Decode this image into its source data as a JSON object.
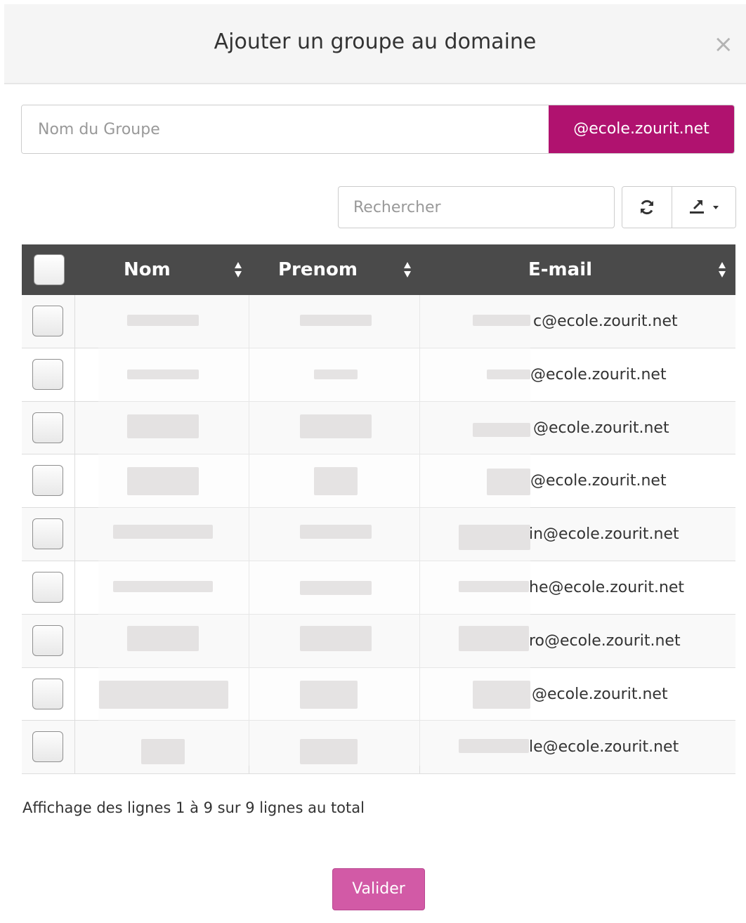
{
  "modal": {
    "title": "Ajouter un groupe au domaine",
    "close_label": "×"
  },
  "group_form": {
    "name_placeholder": "Nom du Groupe",
    "domain_suffix": "@ecole.zourit.net",
    "accent_color": "#b0126f"
  },
  "toolbar": {
    "search_placeholder": "Rechercher",
    "refresh_icon": "refresh-icon",
    "export_icon": "export-icon"
  },
  "table": {
    "header_bg": "#4a4a4a",
    "columns": [
      "Nom",
      "Prenom",
      "E-mail"
    ],
    "rows": [
      {
        "email_visible": "c@ecole.zourit.net"
      },
      {
        "email_visible": "@ecole.zourit.net"
      },
      {
        "email_visible": "@ecole.zourit.net"
      },
      {
        "email_visible": "@ecole.zourit.net"
      },
      {
        "email_visible": "in@ecole.zourit.net"
      },
      {
        "email_visible": "he@ecole.zourit.net"
      },
      {
        "email_visible": "ro@ecole.zourit.net"
      },
      {
        "email_visible": "@ecole.zourit.net"
      },
      {
        "email_visible": "le@ecole.zourit.net"
      }
    ]
  },
  "footer": {
    "pagination_info": "Affichage des lignes 1 à 9 sur 9 lignes au total",
    "submit_label": "Valider",
    "submit_color": "#d25aa6"
  }
}
